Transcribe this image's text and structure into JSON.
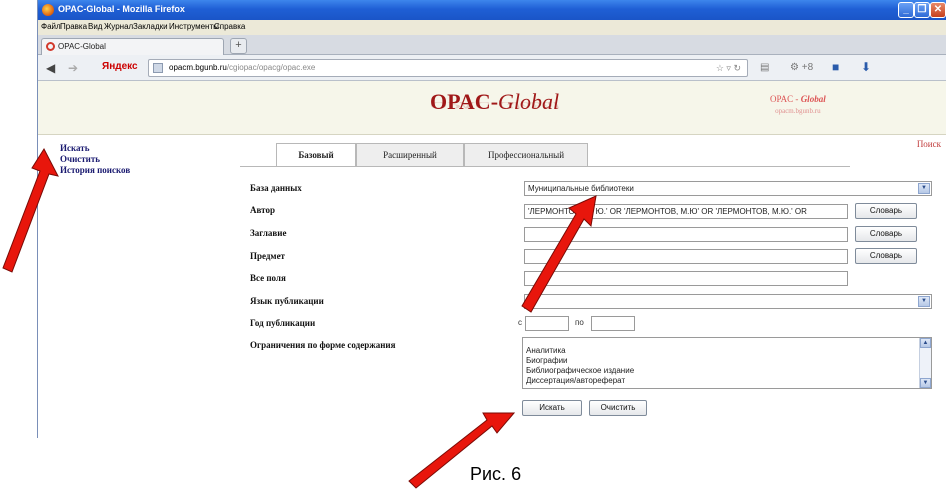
{
  "browser": {
    "title": "OPAC-Global - Mozilla Firefox",
    "menu": [
      "Файл",
      "Правка",
      "Вид",
      "Журнал",
      "Закладки",
      "Инструменты",
      "Справка"
    ],
    "tab_title": "OPAC-Global",
    "new_tab": "+",
    "yandex": "Яндекс",
    "url_host": "opacm.bgunb.ru",
    "url_path": "/cgiopac/opacg/opac.exe",
    "zoom": "+8"
  },
  "header": {
    "logo_prefix": "OPAC-",
    "logo_suffix": "Global",
    "small_logo_prefix": "OPAC - ",
    "small_logo_suffix": "Global",
    "small_logo_sub": "opacm.bgunb.ru"
  },
  "sidebar": {
    "items": [
      {
        "label": "Искать"
      },
      {
        "label": "Очистить"
      },
      {
        "label": "История поисков"
      }
    ]
  },
  "search_link": "Поиск",
  "tabs": [
    {
      "label": "Базовый",
      "active": true
    },
    {
      "label": "Расширенный",
      "active": false
    },
    {
      "label": "Профессиональный",
      "active": false
    }
  ],
  "form": {
    "database": {
      "label": "База данных",
      "value": "Муниципальные библиотеки"
    },
    "author": {
      "label": "Автор",
      "value": "'ЛЕРМОНТОВ, М. Ю.' OR 'ЛЕРМОНТОВ, М.Ю' OR 'ЛЕРМОНТОВ, М.Ю.' OR"
    },
    "title": {
      "label": "Заглавие",
      "value": ""
    },
    "subject": {
      "label": "Предмет",
      "value": ""
    },
    "all_fields": {
      "label": "Все поля",
      "value": ""
    },
    "language": {
      "label": "Язык публикации",
      "value": ""
    },
    "year": {
      "label": "Год публикации",
      "from_label": "с",
      "to_label": "по",
      "from": "",
      "to": ""
    },
    "content_form": {
      "label": "Ограничения по форме содержания",
      "options": [
        "Аналитика",
        "Биографии",
        "Библиографическое издание",
        "Диссертация/автореферат"
      ]
    },
    "dictionary_label": "Словарь",
    "search_button": "Искать",
    "clear_button": "Очистить"
  },
  "caption": "Рис. 6",
  "colors": {
    "arrow": "#e8160c",
    "logo": "#a01818",
    "titlebar": "#1f5fd5"
  }
}
